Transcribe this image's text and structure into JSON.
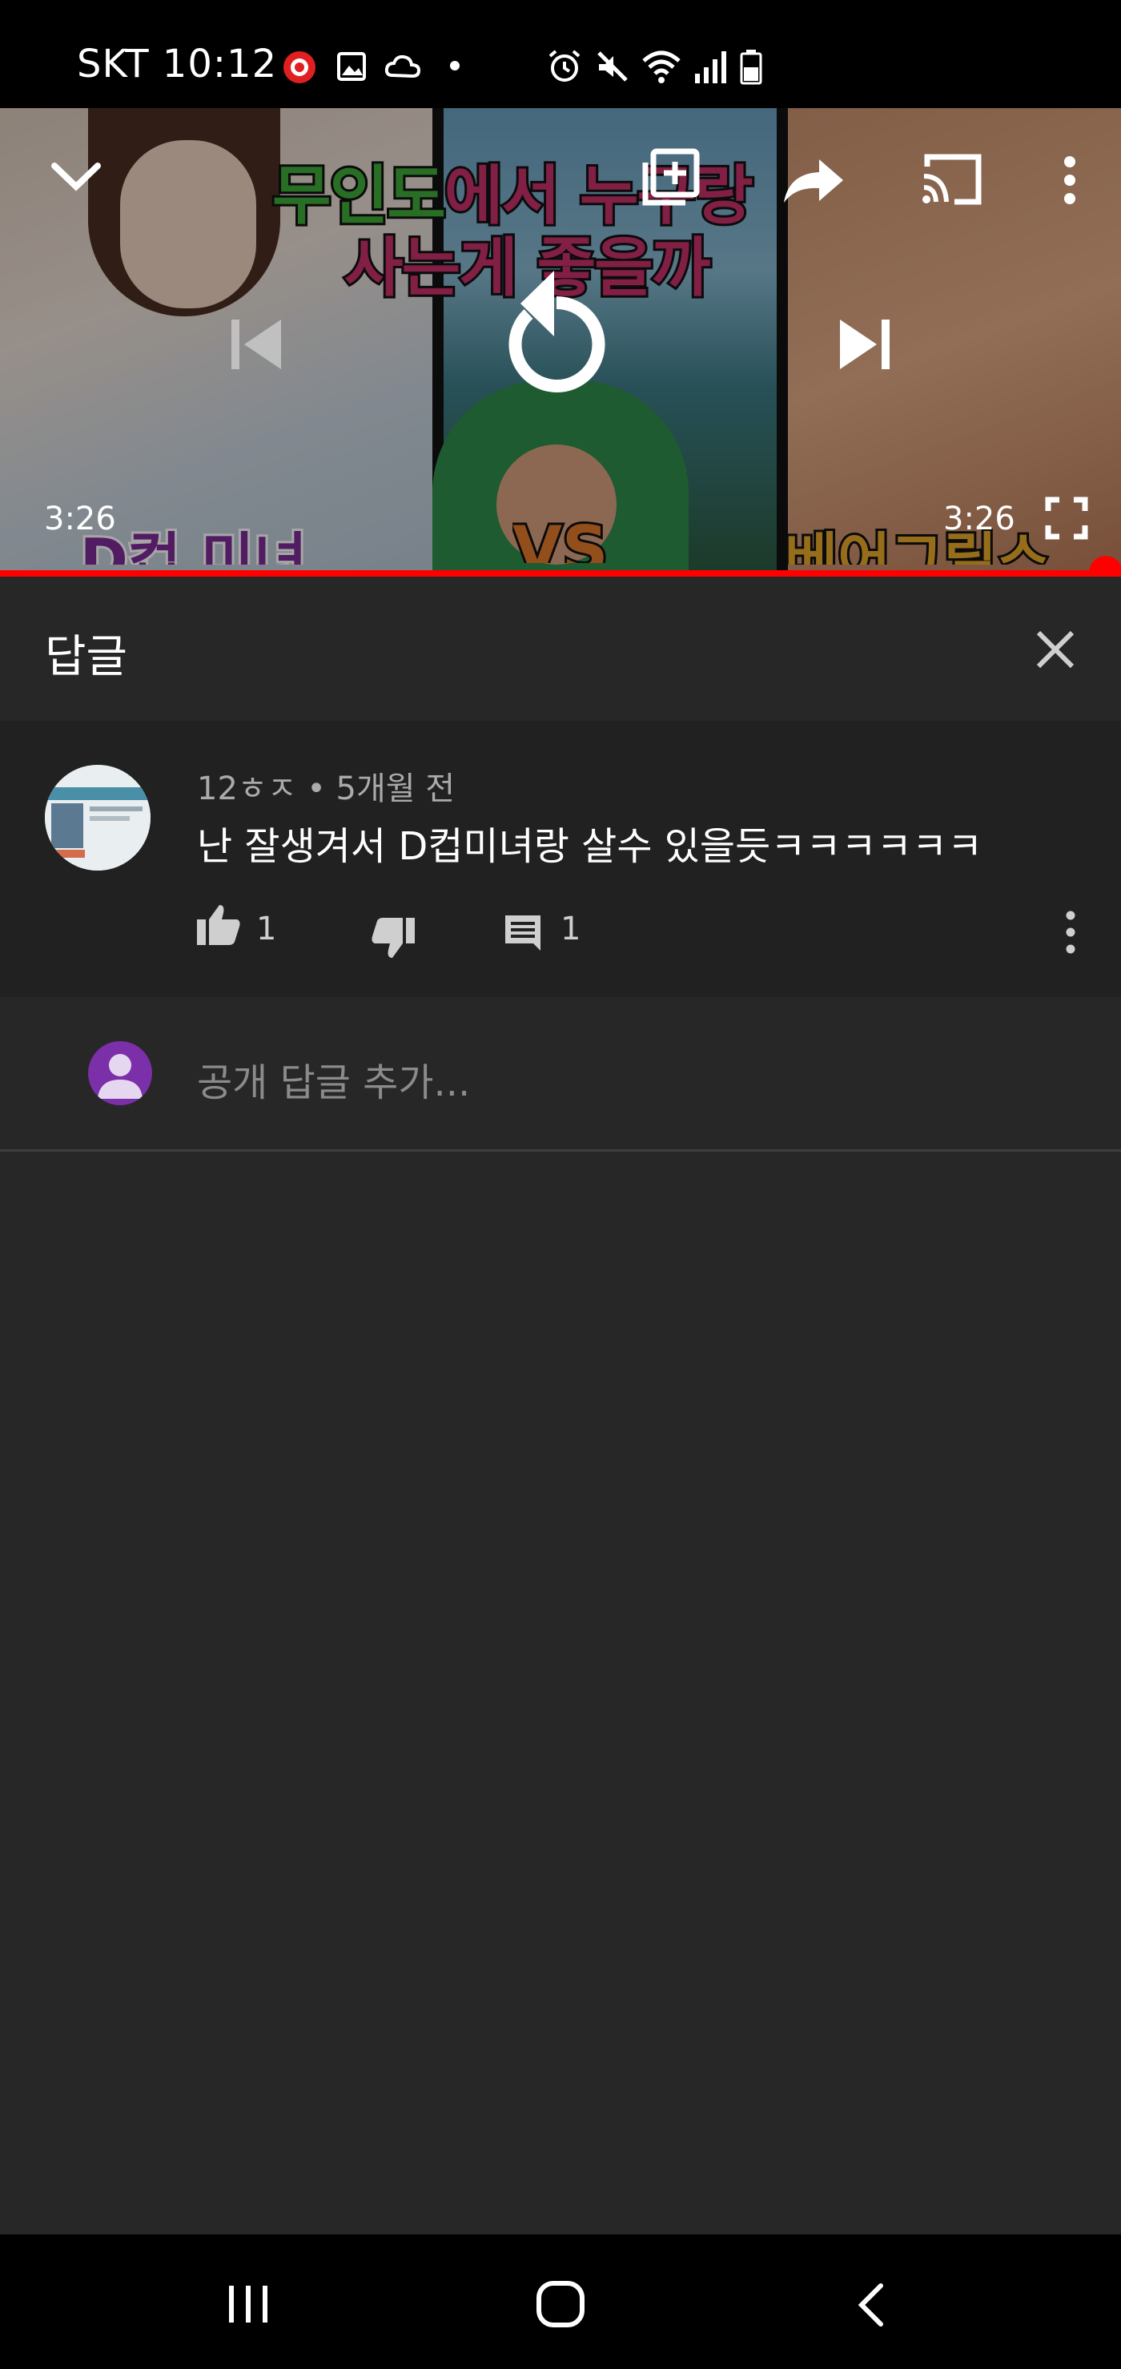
{
  "status_bar": {
    "carrier_time": "SKT 10:12",
    "icons": [
      "app-notification-icon",
      "gallery-icon",
      "cloud-icon",
      "dot-icon",
      "alarm-icon",
      "mute-icon",
      "wifi-icon",
      "signal-icon",
      "battery-icon"
    ]
  },
  "video": {
    "thumbnail_title_line1_green": "무인도",
    "thumbnail_title_line1_rest": "에서 누구랑",
    "thumbnail_title_line2": "사는게 좋을까",
    "thumbnail_left_label": "D컵 미녀",
    "thumbnail_center_label": "VS",
    "thumbnail_right_label": "베어그릴스",
    "time_elapsed": "3:26",
    "time_total": "3:26",
    "progress_fraction": 1.0
  },
  "reply_panel": {
    "title": "답글",
    "comment": {
      "author": "12ㅎㅈ",
      "separator": " • ",
      "age": "5개월 전",
      "text": "난 잘생겨서  D컵미녀랑 살수 있을듯ㅋㅋㅋㅋㅋㅋ",
      "like_count": "1",
      "reply_count": "1"
    },
    "add_reply_placeholder": "공개 답글 추가..."
  },
  "colors": {
    "background": "#272727",
    "card": "#212121",
    "progress": "#ff0000",
    "avatar": "#7b2fa8"
  }
}
